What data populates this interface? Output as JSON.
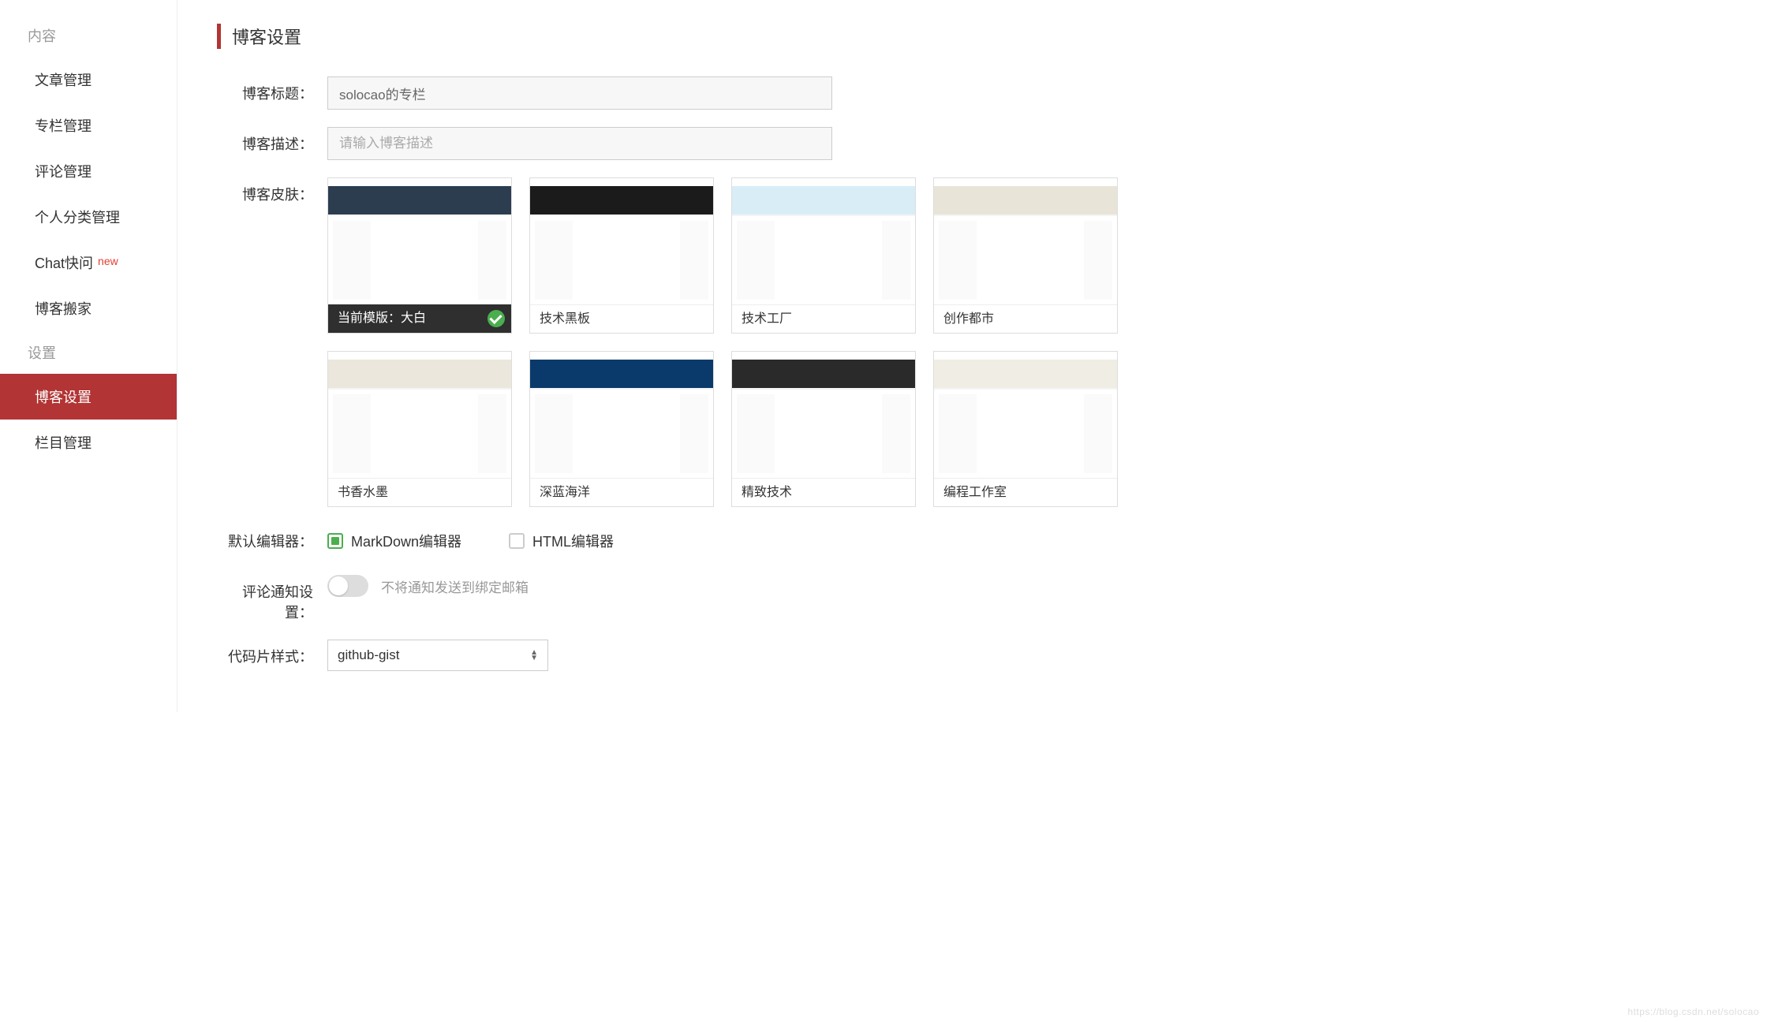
{
  "sidebar": {
    "content_header": "内容",
    "items_content": [
      "文章管理",
      "专栏管理",
      "评论管理",
      "个人分类管理",
      "Chat快问",
      "博客搬家"
    ],
    "chat_badge": "new",
    "settings_header": "设置",
    "items_settings": [
      "博客设置",
      "栏目管理"
    ],
    "active": "博客设置"
  },
  "page_title": "博客设置",
  "form": {
    "blog_title_label": "博客标题：",
    "blog_title_value": "solocao的专栏",
    "blog_desc_label": "博客描述：",
    "blog_desc_placeholder": "请输入博客描述",
    "skin_label": "博客皮肤：",
    "editor_label": "默认编辑器：",
    "notify_label": "评论通知设置：",
    "notify_text": "不将通知发送到绑定邮箱",
    "code_style_label": "代码片样式：",
    "code_style_value": "github-gist"
  },
  "editor_options": [
    {
      "label": "MarkDown编辑器",
      "selected": true
    },
    {
      "label": "HTML编辑器",
      "selected": false
    }
  ],
  "skins": [
    {
      "name": "当前模版：大白",
      "selected": true,
      "hero": "#2d3d50"
    },
    {
      "name": "技术黑板",
      "selected": false,
      "hero": "#1b1b1b"
    },
    {
      "name": "技术工厂",
      "selected": false,
      "hero": "#d9edf7"
    },
    {
      "name": "创作都市",
      "selected": false,
      "hero": "#e8e4d8"
    },
    {
      "name": "书香水墨",
      "selected": false,
      "hero": "#ece7dc"
    },
    {
      "name": "深蓝海洋",
      "selected": false,
      "hero": "#0a3a6b"
    },
    {
      "name": "精致技术",
      "selected": false,
      "hero": "#2a2a2a"
    },
    {
      "name": "编程工作室",
      "selected": false,
      "hero": "#f0ede4"
    }
  ],
  "watermark": "https://blog.csdn.net/solocao"
}
